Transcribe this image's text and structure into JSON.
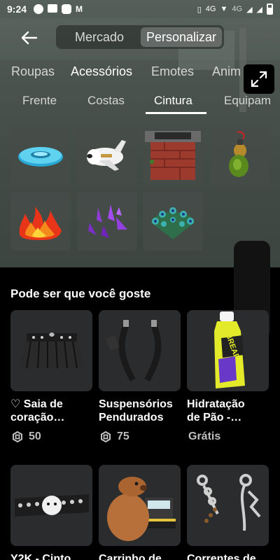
{
  "status_bar": {
    "time": "9:24",
    "network_1": "4G",
    "network_2": "4G"
  },
  "header": {
    "tab_market": "Mercado",
    "tab_customize": "Personalizar"
  },
  "categories": [
    "Roupas",
    "Acessórios",
    "Emotes",
    "Anim"
  ],
  "categories_active": "Acessórios",
  "subcategories": [
    "Frente",
    "Costas",
    "Cintura",
    "Equipam"
  ],
  "subcategories_active": "Cintura",
  "inventory_items": [
    {
      "icon": "blue-ring-float-icon"
    },
    {
      "icon": "airplane-icon"
    },
    {
      "icon": "brick-chimney-icon"
    },
    {
      "icon": "gourd-flask-icon"
    },
    {
      "icon": "fire-flames-icon"
    },
    {
      "icon": "purple-crystals-icon"
    },
    {
      "icon": "peacock-tail-icon"
    }
  ],
  "recommendations": {
    "title": "Pode ser que você goste",
    "items": [
      {
        "name_line1": "♡ Saia de",
        "name_line2": "coração…",
        "price": "50",
        "currency": "robux"
      },
      {
        "name_line1": "Suspensórios",
        "name_line2": "Pendurados",
        "price": "75",
        "currency": "robux"
      },
      {
        "name_line1": "Hidratação",
        "name_line2": "de Pão -…",
        "price": "Grátis",
        "currency": ""
      },
      {
        "name_line1": "Y2K - Cinto",
        "name_line2": "",
        "price": "",
        "currency": ""
      },
      {
        "name_line1": "Carrinho de",
        "name_line2": "",
        "price": "",
        "currency": ""
      },
      {
        "name_line1": "Correntes de",
        "name_line2": "",
        "price": "",
        "currency": ""
      }
    ]
  },
  "bottle_text": "BREAD",
  "colors": {
    "background": "#000000",
    "card": "#2b2c2e",
    "scene": "#4a534e",
    "accent": "#ffffff"
  }
}
